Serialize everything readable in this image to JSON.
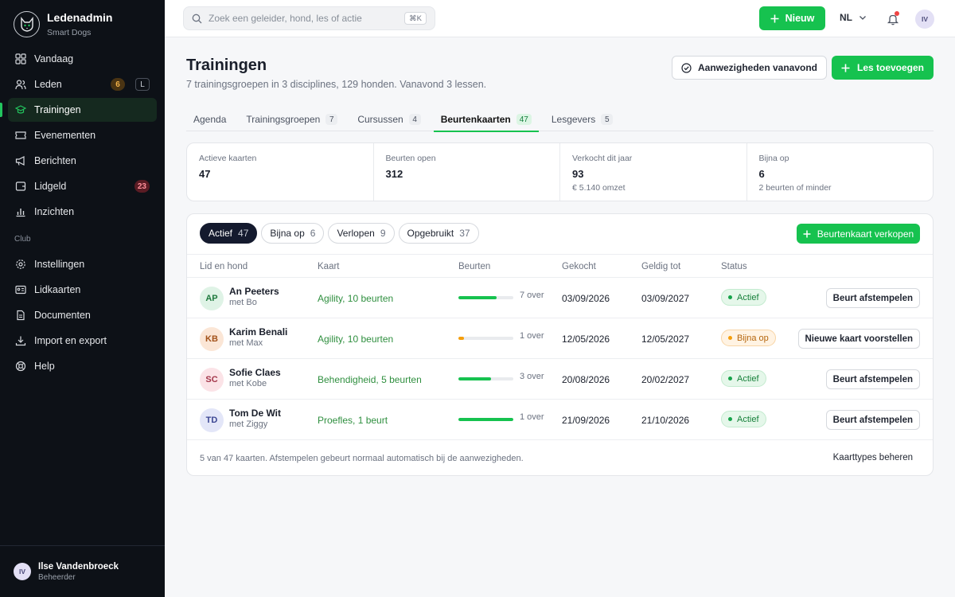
{
  "app": {
    "name": "Ledenadmin",
    "subtitle": "Smart Dogs"
  },
  "nav": [
    {
      "label": "Vandaag",
      "icon": "grid-icon"
    },
    {
      "label": "Leden",
      "icon": "users-icon",
      "badge": "6",
      "kbd": "L"
    },
    {
      "label": "Trainingen",
      "icon": "graduation-cap-icon",
      "active": true
    },
    {
      "label": "Evenementen",
      "icon": "ticket-icon"
    },
    {
      "label": "Berichten",
      "icon": "megaphone-icon"
    },
    {
      "label": "Lidgeld",
      "icon": "wallet-icon",
      "badge": "23"
    },
    {
      "label": "Inzichten",
      "icon": "bar-chart-icon"
    }
  ],
  "nav_section": "Club",
  "nav2": [
    {
      "label": "Instellingen",
      "icon": "gear-icon"
    },
    {
      "label": "Lidkaarten",
      "icon": "id-card-icon"
    },
    {
      "label": "Documenten",
      "icon": "document-icon"
    },
    {
      "label": "Import en export",
      "icon": "download-icon"
    },
    {
      "label": "Help",
      "icon": "lifebuoy-icon"
    }
  ],
  "user": {
    "initials": "IV",
    "name": "Ilse Vandenbroeck",
    "role": "Beheerder"
  },
  "topbar": {
    "search_placeholder": "Zoek een geleider, hond, les of actie",
    "search_kbd": "⌘K",
    "new_label": "Nieuw",
    "lang": "NL",
    "avatar": "IV"
  },
  "page": {
    "title": "Trainingen",
    "subtitle": "7 trainingsgroepen in 3 disciplines, 129 honden. Vanavond 3 lessen.",
    "btn_attendance": "Aanwezigheden vanavond",
    "btn_add": "Les toevoegen"
  },
  "tabs": [
    {
      "label": "Agenda",
      "count": ""
    },
    {
      "label": "Trainingsgroepen",
      "count": "7"
    },
    {
      "label": "Cursussen",
      "count": "4"
    },
    {
      "label": "Beurtenkaarten",
      "count": "47"
    },
    {
      "label": "Lesgevers",
      "count": "5"
    }
  ],
  "stats": [
    {
      "label": "Actieve kaarten",
      "value": "47",
      "note": ""
    },
    {
      "label": "Beurten open",
      "value": "312",
      "note": ""
    },
    {
      "label": "Verkocht dit jaar",
      "value": "93",
      "note": "€ 5.140 omzet"
    },
    {
      "label": "Bijna op",
      "value": "6",
      "note": "2 beurten of minder"
    }
  ],
  "filters": [
    {
      "label": "Actief",
      "count": "47"
    },
    {
      "label": "Bijna op",
      "count": "6"
    },
    {
      "label": "Verlopen",
      "count": "9"
    },
    {
      "label": "Opgebruikt",
      "count": "37"
    }
  ],
  "sell_button": "Beurtenkaart verkopen",
  "columns": [
    "Lid en hond",
    "Kaart",
    "Beurten",
    "Gekocht",
    "Geldig tot",
    "Status"
  ],
  "rows": [
    {
      "initials": "AP",
      "name": "An Peeters",
      "dog": "met Bo",
      "card": "Agility, 10 beurten",
      "progress": 0.7,
      "left": "7 over",
      "bought": "03/09/2026",
      "valid": "03/09/2027",
      "status": "Actief",
      "action": "Beurt afstempelen",
      "avatar_bg": "#dff3e6",
      "avatar_fg": "#1f7a3e"
    },
    {
      "initials": "KB",
      "name": "Karim Benali",
      "dog": "met Max",
      "card": "Agility, 10 beurten",
      "progress": 0.1,
      "left": "1 over",
      "bought": "12/05/2026",
      "valid": "12/05/2027",
      "status": "Bijna op",
      "action": "Nieuwe kaart voorstellen",
      "avatar_bg": "#fbe6d6",
      "avatar_fg": "#a3521a"
    },
    {
      "initials": "SC",
      "name": "Sofie Claes",
      "dog": "met Kobe",
      "card": "Behendigheid, 5 beurten",
      "progress": 0.6,
      "left": "3 over",
      "bought": "20/08/2026",
      "valid": "20/02/2027",
      "status": "Actief",
      "action": "Beurt afstempelen",
      "avatar_bg": "#fbe3e7",
      "avatar_fg": "#a3364a"
    },
    {
      "initials": "TD",
      "name": "Tom De Wit",
      "dog": "met Ziggy",
      "card": "Proefles, 1 beurt",
      "progress": 1.0,
      "left": "1 over",
      "bought": "21/09/2026",
      "valid": "21/10/2026",
      "status": "Actief",
      "action": "Beurt afstempelen",
      "avatar_bg": "#e3e6f8",
      "avatar_fg": "#3b4592"
    }
  ],
  "footer": {
    "note": "5 van 47 kaarten. Afstempelen gebeurt normaal automatisch bij de aanwezigheden.",
    "link": "Kaarttypes beheren"
  },
  "colors": {
    "accent": "#16c24f",
    "sidebar": "#0d1117",
    "progress_green": "#16c24f",
    "progress_amber": "#f59e0b"
  }
}
